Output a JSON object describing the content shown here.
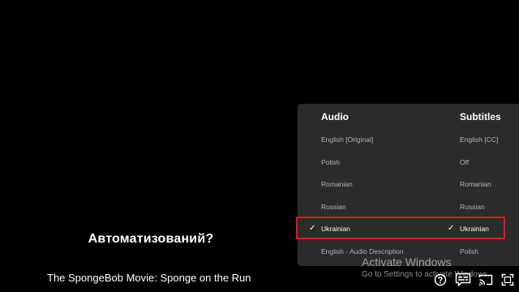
{
  "caption": "Автоматизований?",
  "video_title": "The SpongeBob Movie: Sponge on the Run",
  "menu": {
    "audio_header": "Audio",
    "subtitles_header": "Subtitles",
    "audio_options": [
      {
        "label": "English [Original]",
        "selected": false
      },
      {
        "label": "Polish",
        "selected": false
      },
      {
        "label": "Romanian",
        "selected": false
      },
      {
        "label": "Russian",
        "selected": false
      },
      {
        "label": "Ukrainian",
        "selected": true
      },
      {
        "label": "English - Audio Description",
        "selected": false
      }
    ],
    "subtitle_options": [
      {
        "label": "English [CC]",
        "selected": false
      },
      {
        "label": "Off",
        "selected": false
      },
      {
        "label": "Romanian",
        "selected": false
      },
      {
        "label": "Russian",
        "selected": false
      },
      {
        "label": "Ukrainian",
        "selected": true
      },
      {
        "label": "Polish",
        "selected": false
      }
    ],
    "check_glyph": "✓"
  },
  "watermark": {
    "line1": "Activate Windows",
    "line2": "Go to Settings to activate Windows."
  },
  "controls": {
    "help_icon": "help-icon",
    "subtitles_icon": "subtitles-audio-icon",
    "cast_icon": "cast-icon",
    "fullscreen_icon": "fullscreen-icon"
  },
  "colors": {
    "highlight": "#e01919",
    "panel": "#2b2b2b"
  }
}
